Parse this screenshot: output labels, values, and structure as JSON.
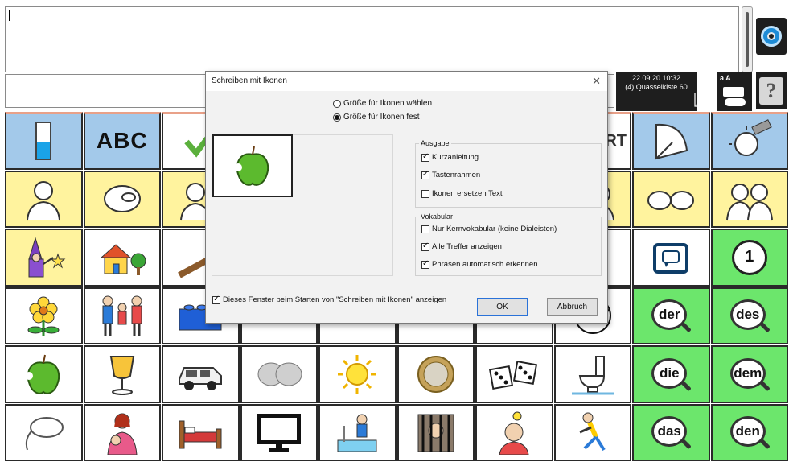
{
  "dialog": {
    "title": "Schreiben mit Ikonen",
    "close_glyph": "✕",
    "radio_choose_size": "Größe für Ikonen wählen",
    "radio_fixed_size": "Größe für Ikonen fest",
    "output_group": "Ausgabe",
    "output_options": [
      "Kurzanleitung",
      "Tastenrahmen",
      "Ikonen ersetzen Text"
    ],
    "vocab_group": "Vokabular",
    "vocab_options": [
      "Nur Kernvokabular (keine Dialeisten)",
      "Alle Treffer anzeigen",
      "Phrasen automatisch erkennen"
    ],
    "show_on_start": "Dieses Fenster beim Starten von \"Schreiben mit Ikonen\" anzeigen",
    "ok_label": "OK",
    "cancel_label": "Abbruch",
    "checked": {
      "output": [
        true,
        true,
        false
      ],
      "vocab": [
        false,
        true,
        true
      ],
      "show_on_start": true
    },
    "radio_selected": "fixed"
  },
  "status": {
    "datetime": "22.09.20 10:32",
    "profile": "(4) Quasselkiste 60",
    "kbd_letters": "a A"
  },
  "toolbar": {
    "help_glyph": "?",
    "abc_label": "ABC",
    "rt_fragment": "RT"
  },
  "words": {
    "der": "der",
    "des": "des",
    "die": "die",
    "dem": "dem",
    "das": "das",
    "den": "den",
    "one": "1"
  },
  "colors": {
    "blue_cell": "#a3c9ea",
    "yellow_cell": "#fff39e",
    "green_cell": "#6ce66c",
    "row_accent": "#e9a189"
  },
  "icons": [
    "battery-icon",
    "abc-icon",
    "checkmark-icon",
    "start-icon",
    "fan-icon",
    "eraser-icon",
    "man-signing-icon",
    "pointing-hand-icon",
    "person-icon",
    "woman-icon",
    "two-hands-icon",
    "two-people-icon",
    "wizard-icon",
    "house-icon",
    "stick-icon",
    "lips-icon",
    "tablet-icon",
    "flower-icon",
    "family-icon",
    "lego-block-icon",
    "soccer-ball-icon",
    "apple-icon",
    "glass-icon",
    "car-icon",
    "elephant-icon",
    "sun-icon",
    "coin-icon",
    "dice-icon",
    "toilet-icon",
    "computer-mouse-icon",
    "mother-baby-icon",
    "bed-icon",
    "monitor-icon",
    "swimming-pool-icon",
    "prison-icon",
    "idea-person-icon",
    "running-person-icon"
  ]
}
